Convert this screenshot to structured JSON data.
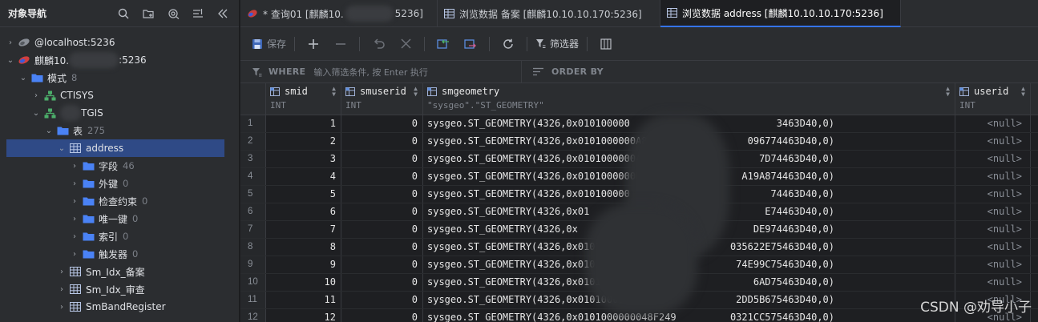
{
  "navigator": {
    "title": "对象导航",
    "tools": [
      "search-icon",
      "new-folder-icon",
      "connect-icon",
      "filter-list-icon",
      "collapse-icon"
    ],
    "tree": [
      {
        "name": "localhost-connection",
        "label": "@localhost:5236",
        "indent": 0,
        "arrow": "›",
        "icon": "db-gray",
        "count": ""
      },
      {
        "name": "kylin-connection",
        "label": "麒麟10.",
        "label_suffix": ":5236",
        "indent": 0,
        "arrow": "⌄",
        "icon": "db-color",
        "count": ""
      },
      {
        "name": "schema-folder",
        "label": "模式",
        "indent": 1,
        "arrow": "⌄",
        "icon": "folder",
        "count": "8"
      },
      {
        "name": "schema-ctisys",
        "label": "CTISYS",
        "indent": 2,
        "arrow": "›",
        "icon": "schema",
        "count": ""
      },
      {
        "name": "schema-ctgis",
        "label": "TGIS",
        "indent": 2,
        "arrow": "⌄",
        "icon": "schema",
        "count": ""
      },
      {
        "name": "table-folder",
        "label": "表",
        "indent": 3,
        "arrow": "⌄",
        "icon": "folder",
        "count": "275"
      },
      {
        "name": "table-address",
        "label": "address",
        "indent": 4,
        "arrow": "⌄",
        "icon": "table",
        "count": "",
        "selected": true
      },
      {
        "name": "fields-folder",
        "label": "字段",
        "indent": 5,
        "arrow": "›",
        "icon": "folder",
        "count": "46"
      },
      {
        "name": "foreign-keys-folder",
        "label": "外键",
        "indent": 5,
        "arrow": "›",
        "icon": "folder",
        "count": "0"
      },
      {
        "name": "check-constraints-folder",
        "label": "检查约束",
        "indent": 5,
        "arrow": "›",
        "icon": "folder",
        "count": "0"
      },
      {
        "name": "unique-keys-folder",
        "label": "唯一键",
        "indent": 5,
        "arrow": "›",
        "icon": "folder",
        "count": "0"
      },
      {
        "name": "indexes-folder",
        "label": "索引",
        "indent": 5,
        "arrow": "›",
        "icon": "folder",
        "count": "0"
      },
      {
        "name": "triggers-folder",
        "label": "触发器",
        "indent": 5,
        "arrow": "›",
        "icon": "folder",
        "count": "0"
      },
      {
        "name": "table-sm-idx-backup",
        "label": "Sm_Idx_备案",
        "indent": 4,
        "arrow": "›",
        "icon": "table",
        "count": ""
      },
      {
        "name": "table-sm-idx-review",
        "label": "Sm_Idx_审查",
        "indent": 4,
        "arrow": "›",
        "icon": "table",
        "count": ""
      },
      {
        "name": "table-smbandregister",
        "label": "SmBandRegister",
        "indent": 4,
        "arrow": "›",
        "icon": "table",
        "count": ""
      }
    ]
  },
  "tabs": [
    {
      "label": "* 查询01 [麒麟10.",
      "label_suffix": "5236]",
      "icon": "query-icon",
      "active": false
    },
    {
      "label": "浏览数据 备案 [麒麟10.10.10.170:5236]",
      "icon": "table-icon",
      "active": false
    },
    {
      "label": "浏览数据 address [麒麟10.10.10.170:5236]",
      "icon": "table-icon",
      "active": true
    }
  ],
  "toolbar": {
    "save_label": "保存",
    "filter_label": "筛选器"
  },
  "filterbar": {
    "where_key": "WHERE",
    "where_placeholder": "输入筛选条件, 按 Enter 执行",
    "order_key": "ORDER BY"
  },
  "grid": {
    "columns": [
      {
        "name": "smid",
        "type": "INT"
      },
      {
        "name": "smuserid",
        "type": "INT"
      },
      {
        "name": "smgeometry",
        "type": "\"sysgeo\".\"ST_GEOMETRY\""
      },
      {
        "name": "userid",
        "type": "INT"
      }
    ],
    "rows": [
      {
        "n": "1",
        "smid": "1",
        "smuserid": "0",
        "geo": "sysgeo.ST_GEOMETRY(4326,0x010100000",
        "geo_tail": "3463D40,0)",
        "userid": "<null>"
      },
      {
        "n": "2",
        "smid": "2",
        "smuserid": "0",
        "geo": "sysgeo.ST_GEOMETRY(4326,0x0101000000A8FCAF035F",
        "geo_tail": "096774463D40,0)",
        "userid": "<null>"
      },
      {
        "n": "3",
        "smid": "3",
        "smuserid": "0",
        "geo": "sysgeo.ST_GEOMETRY(4326,0x0101000000402",
        "geo_tail": "7D74463D40,0)",
        "userid": "<null>"
      },
      {
        "n": "4",
        "smid": "4",
        "smuserid": "0",
        "geo": "sysgeo.ST_GEOMETRY(4326,0x0101000000B0",
        "geo_tail": "A19A874463D40,0)",
        "userid": "<null>"
      },
      {
        "n": "5",
        "smid": "5",
        "smuserid": "0",
        "geo": "sysgeo.ST_GEOMETRY(4326,0x010100000",
        "geo_tail": "74463D40,0)",
        "userid": "<null>"
      },
      {
        "n": "6",
        "smid": "6",
        "smuserid": "0",
        "geo": "sysgeo.ST_GEOMETRY(4326,0x01",
        "geo_tail": "E74463D40,0)",
        "userid": "<null>"
      },
      {
        "n": "7",
        "smid": "7",
        "smuserid": "0",
        "geo": "sysgeo.ST_GEOMETRY(4326,0x",
        "geo_tail": "DE974463D40,0)",
        "userid": "<null>"
      },
      {
        "n": "8",
        "smid": "8",
        "smuserid": "0",
        "geo": "sysgeo.ST_GEOMETRY(4326,0x010100000080B",
        "geo_tail": "035622E75463D40,0)",
        "userid": "<null>"
      },
      {
        "n": "9",
        "smid": "9",
        "smuserid": "0",
        "geo": "sysgeo.ST_GEOMETRY(4326,0x0101000000F0C3EEF9",
        "geo_tail": "74E99C75463D40,0)",
        "userid": "<null>"
      },
      {
        "n": "10",
        "smid": "10",
        "smuserid": "0",
        "geo": "sysgeo.ST_GEOMETRY(4326,0x0101000000D0",
        "geo_tail": "6AD75463D40,0)",
        "userid": "<null>"
      },
      {
        "n": "11",
        "smid": "11",
        "smuserid": "0",
        "geo": "sysgeo.ST_GEOMETRY(4326,0x0101000000016",
        "geo_tail": "2DD5B675463D40,0)",
        "userid": "<null>"
      },
      {
        "n": "12",
        "smid": "12",
        "smuserid": "0",
        "geo": "sysgeo.ST_GEOMETRY(4326,0x0101000000048F249",
        "geo_tail": "0321CC575463D40,0)",
        "userid": "<null>"
      }
    ]
  },
  "watermark": "CSDN @劝导小子",
  "colors": {
    "accent": "#3574f0",
    "selected_row": "#2f4a86",
    "folder": "#4a82f5",
    "schema": "#4cae6a"
  }
}
